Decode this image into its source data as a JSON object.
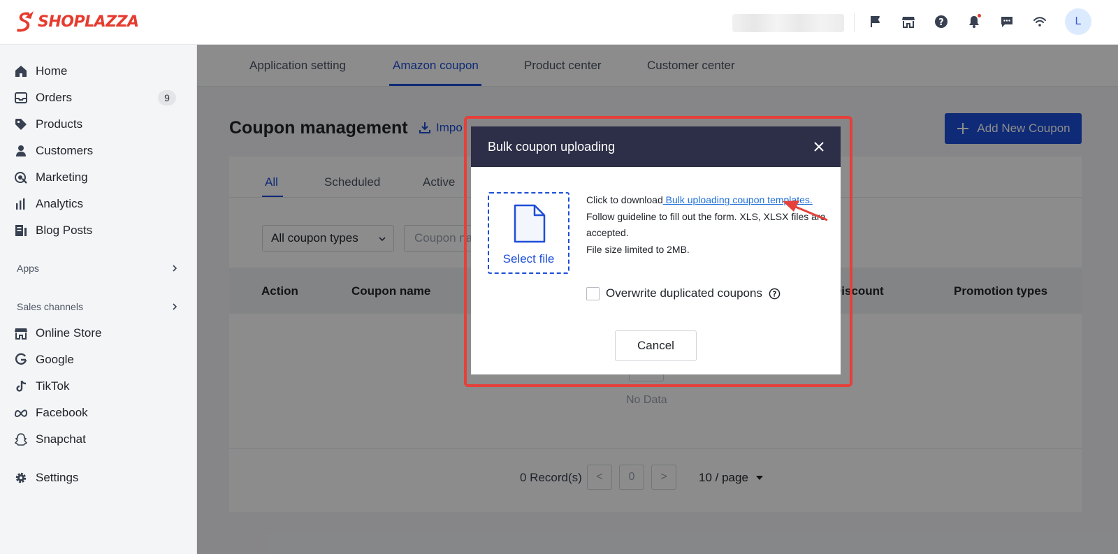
{
  "app": {
    "brand": "SHOPLAZZA",
    "brand_color": "#e63b2e",
    "accent": "#1d4ed8"
  },
  "topbar": {
    "icons": [
      "flag-icon",
      "store-icon",
      "help-icon",
      "bell-icon",
      "chat-icon",
      "wifi-icon"
    ],
    "avatar_initial": "L"
  },
  "sidebar": {
    "items": [
      {
        "label": "Home",
        "icon": "home-icon"
      },
      {
        "label": "Orders",
        "icon": "orders-icon",
        "badge": "9"
      },
      {
        "label": "Products",
        "icon": "tag-icon"
      },
      {
        "label": "Customers",
        "icon": "person-icon"
      },
      {
        "label": "Marketing",
        "icon": "marketing-icon"
      },
      {
        "label": "Analytics",
        "icon": "bar-chart-icon"
      },
      {
        "label": "Blog Posts",
        "icon": "blog-icon"
      }
    ],
    "apps_label": "Apps",
    "sales_channels_label": "Sales channels",
    "channels": [
      {
        "label": "Online Store",
        "icon": "store-icon"
      },
      {
        "label": "Google",
        "icon": "google-icon"
      },
      {
        "label": "TikTok",
        "icon": "tiktok-icon"
      },
      {
        "label": "Facebook",
        "icon": "meta-icon"
      },
      {
        "label": "Snapchat",
        "icon": "snapchat-icon"
      }
    ],
    "settings_label": "Settings"
  },
  "main": {
    "tabs": [
      "Application setting",
      "Amazon coupon",
      "Product center",
      "Customer center"
    ],
    "active_tab": "Amazon coupon",
    "page_title": "Coupon management",
    "import_label": "Impo",
    "add_button": "Add New Coupon",
    "status_tabs": [
      "All",
      "Scheduled",
      "Active"
    ],
    "filter_type": "All coupon types",
    "search_placeholder": "Coupon na",
    "table_headers": [
      "Action",
      "Coupon name",
      "Discount",
      "Promotion types"
    ],
    "empty_text": "No Data",
    "records": "0 Record(s)",
    "prev": "<",
    "page": "0",
    "next": ">",
    "per_page": "10 / page"
  },
  "modal": {
    "title": "Bulk coupon uploading",
    "select_file": "Select file",
    "download_prefix": "Click to download",
    "download_link": " Bulk uploading coupon templates.",
    "guideline": "Follow guideline to fill out the form. XLS, XLSX files are accepted.",
    "size_limit": "File size limited to 2MB.",
    "overwrite_label": "Overwrite duplicated coupons",
    "cancel": "Cancel"
  }
}
